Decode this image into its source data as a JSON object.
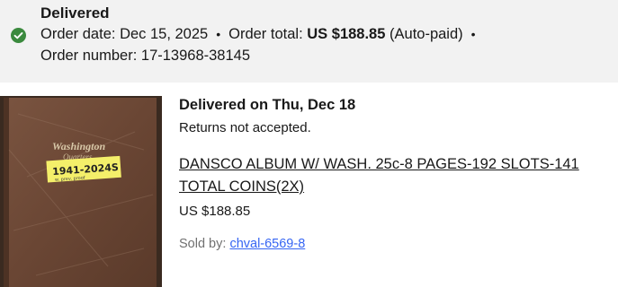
{
  "order": {
    "status": "Delivered",
    "order_date_label": "Order date:",
    "order_date": "Dec 15, 2025",
    "separator": "•",
    "total_label": "Order total:",
    "total_value": "US $188.85",
    "payment_note": "(Auto-paid)",
    "number_label": "Order number:",
    "number": "17-13968-38145",
    "status_color": "#3b8a3e"
  },
  "item": {
    "delivered_on": "Delivered on Thu, Dec 18",
    "returns": "Returns not accepted.",
    "title": "DANSCO ALBUM W/ WASH. 25c-8 PAGES-192 SLOTS-141 TOTAL COINS(2X)",
    "price": "US $188.85",
    "seller_label": "Sold by:",
    "seller_name": "chval-6569-8",
    "image": {
      "album_text": "Washington",
      "album_subtext": "Quarters",
      "label_text": "1941-2024S",
      "label_subtext": "w. prev. proof"
    }
  }
}
